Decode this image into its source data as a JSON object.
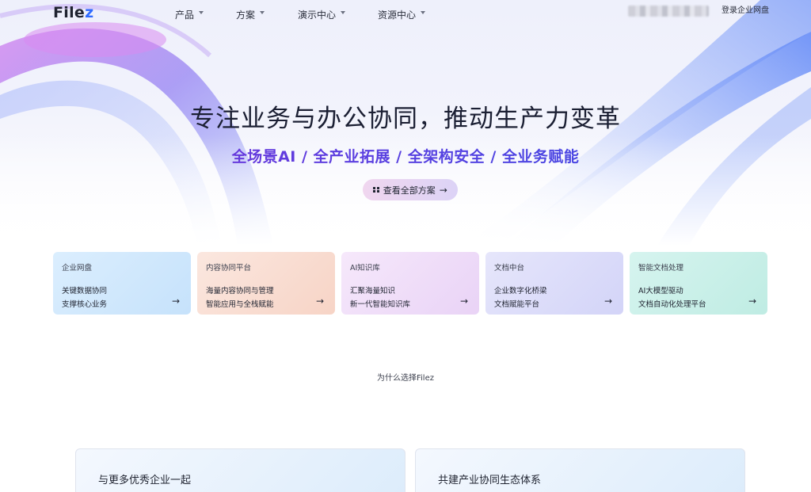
{
  "header": {
    "logo_main": "File",
    "logo_accent": "z",
    "nav": [
      {
        "label": "产品"
      },
      {
        "label": "方案"
      },
      {
        "label": "演示中心"
      },
      {
        "label": "资源中心"
      }
    ],
    "login_label": "登录企业网盘"
  },
  "hero": {
    "title": "专注业务与办公协同，推动生产力变革",
    "subtitle": "全场景AI / 全产业拓展 / 全架构安全 / 全业务赋能",
    "cta_label": "查看全部方案",
    "cta_arrow": "→"
  },
  "cards": [
    {
      "title": "企业网盘",
      "line1": "关键数据协同",
      "line2": "支撑核心业务",
      "arrow": "→"
    },
    {
      "title": "内容协同平台",
      "line1": "海量内容协同与管理",
      "line2": "智能应用与全栈赋能",
      "arrow": "→"
    },
    {
      "title": "AI知识库",
      "line1": "汇聚海量知识",
      "line2": "新一代智能知识库",
      "arrow": "→"
    },
    {
      "title": "文档中台",
      "line1": "企业数字化桥梁",
      "line2": "文档赋能平台",
      "arrow": "→"
    },
    {
      "title": "智能文档处理",
      "line1": "AI大模型驱动",
      "line2": "文档自动化处理平台",
      "arrow": "→"
    }
  ],
  "why": {
    "title": "为什么选择Filez",
    "panels": [
      {
        "title": "与更多优秀企业一起"
      },
      {
        "title": "共建产业协同生态体系"
      }
    ]
  },
  "colors": {
    "brand_blue": "#2f6bff",
    "subtitle_gradient_start": "#7a2fd6",
    "subtitle_gradient_end": "#3a4fe6"
  }
}
